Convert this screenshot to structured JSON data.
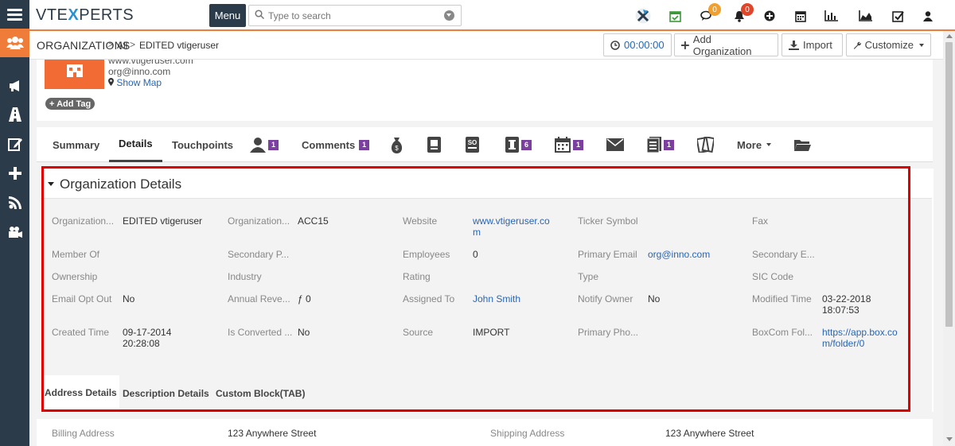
{
  "header": {
    "logo_text": "VTE",
    "logo_x": "X",
    "logo_rest": "PERTS",
    "menu_label": "Menu",
    "search_placeholder": "Type to search",
    "chat_count": "0",
    "notif_count": "0"
  },
  "sidebar": {
    "items": [
      "menu-icon",
      "users-icon",
      "megaphone-icon",
      "road-icon",
      "edit-icon",
      "plus-icon",
      "rss-icon",
      "video-icon"
    ]
  },
  "breadcrumb": {
    "module": "ORGANIZATIONS",
    "sep": ">",
    "all": "All",
    "record": "EDITED vtigeruser"
  },
  "actions": {
    "timer": "00:00:00",
    "add_org": "Add Organization",
    "import": "Import",
    "customize": "Customize"
  },
  "record": {
    "website": "www.vtigeruser.com",
    "email": "org@inno.com",
    "show_map": "Show Map",
    "add_tag": "+ Add Tag"
  },
  "tabs": {
    "summary": "Summary",
    "details": "Details",
    "touchpoints": "Touchpoints",
    "contacts_count": "1",
    "comments": "Comments",
    "comments_count": "1",
    "tickets_count": "6",
    "events_count": "1",
    "documents_count": "1",
    "more": "More"
  },
  "details": {
    "title": "Organization Details",
    "fields": {
      "org_name_label": "Organization...",
      "org_name_value": "EDITED vtigeruser",
      "org_no_label": "Organization...",
      "org_no_value": "ACC15",
      "website_label": "Website",
      "website_value_1": "www.vtigeruser.co",
      "website_value_2": "m",
      "ticker_label": "Ticker Symbol",
      "fax_label": "Fax",
      "member_of_label": "Member Of",
      "secondary_phone_label": "Secondary P...",
      "employees_label": "Employees",
      "employees_value": "0",
      "primary_email_label": "Primary Email",
      "primary_email_value": "org@inno.com",
      "secondary_email_label": "Secondary E...",
      "ownership_label": "Ownership",
      "industry_label": "Industry",
      "rating_label": "Rating",
      "type_label": "Type",
      "sic_label": "SIC Code",
      "opt_out_label": "Email Opt Out",
      "opt_out_value": "No",
      "revenue_label": "Annual Reve...",
      "revenue_value": "ƒ 0",
      "assigned_label": "Assigned To",
      "assigned_value": "John Smith",
      "notify_label": "Notify Owner",
      "notify_value": "No",
      "modified_label": "Modified Time",
      "modified_value_1": "03-22-2018",
      "modified_value_2": "18:07:53",
      "created_label": "Created Time",
      "created_value_1": "09-17-2014",
      "created_value_2": "20:28:08",
      "converted_label": "Is Converted ...",
      "converted_value": "No",
      "source_label": "Source",
      "source_value": "IMPORT",
      "primary_phone_label": "Primary Pho...",
      "boxcom_label": "BoxCom Fol...",
      "boxcom_value_1": "https://app.box.co",
      "boxcom_value_2": "m/folder/0"
    },
    "subtabs": [
      "Address Details",
      "Description Details",
      "Custom Block(TAB)"
    ]
  },
  "address": {
    "billing_label": "Billing Address",
    "billing_value": "123 Anywhere Street",
    "shipping_label": "Shipping Address",
    "shipping_value": "123 Anywhere Street"
  },
  "colors": {
    "accent": "#f07c39",
    "sidebar": "#2c3b49",
    "highlight_box": "#e00000",
    "badge_purple": "#7b3fa0"
  }
}
